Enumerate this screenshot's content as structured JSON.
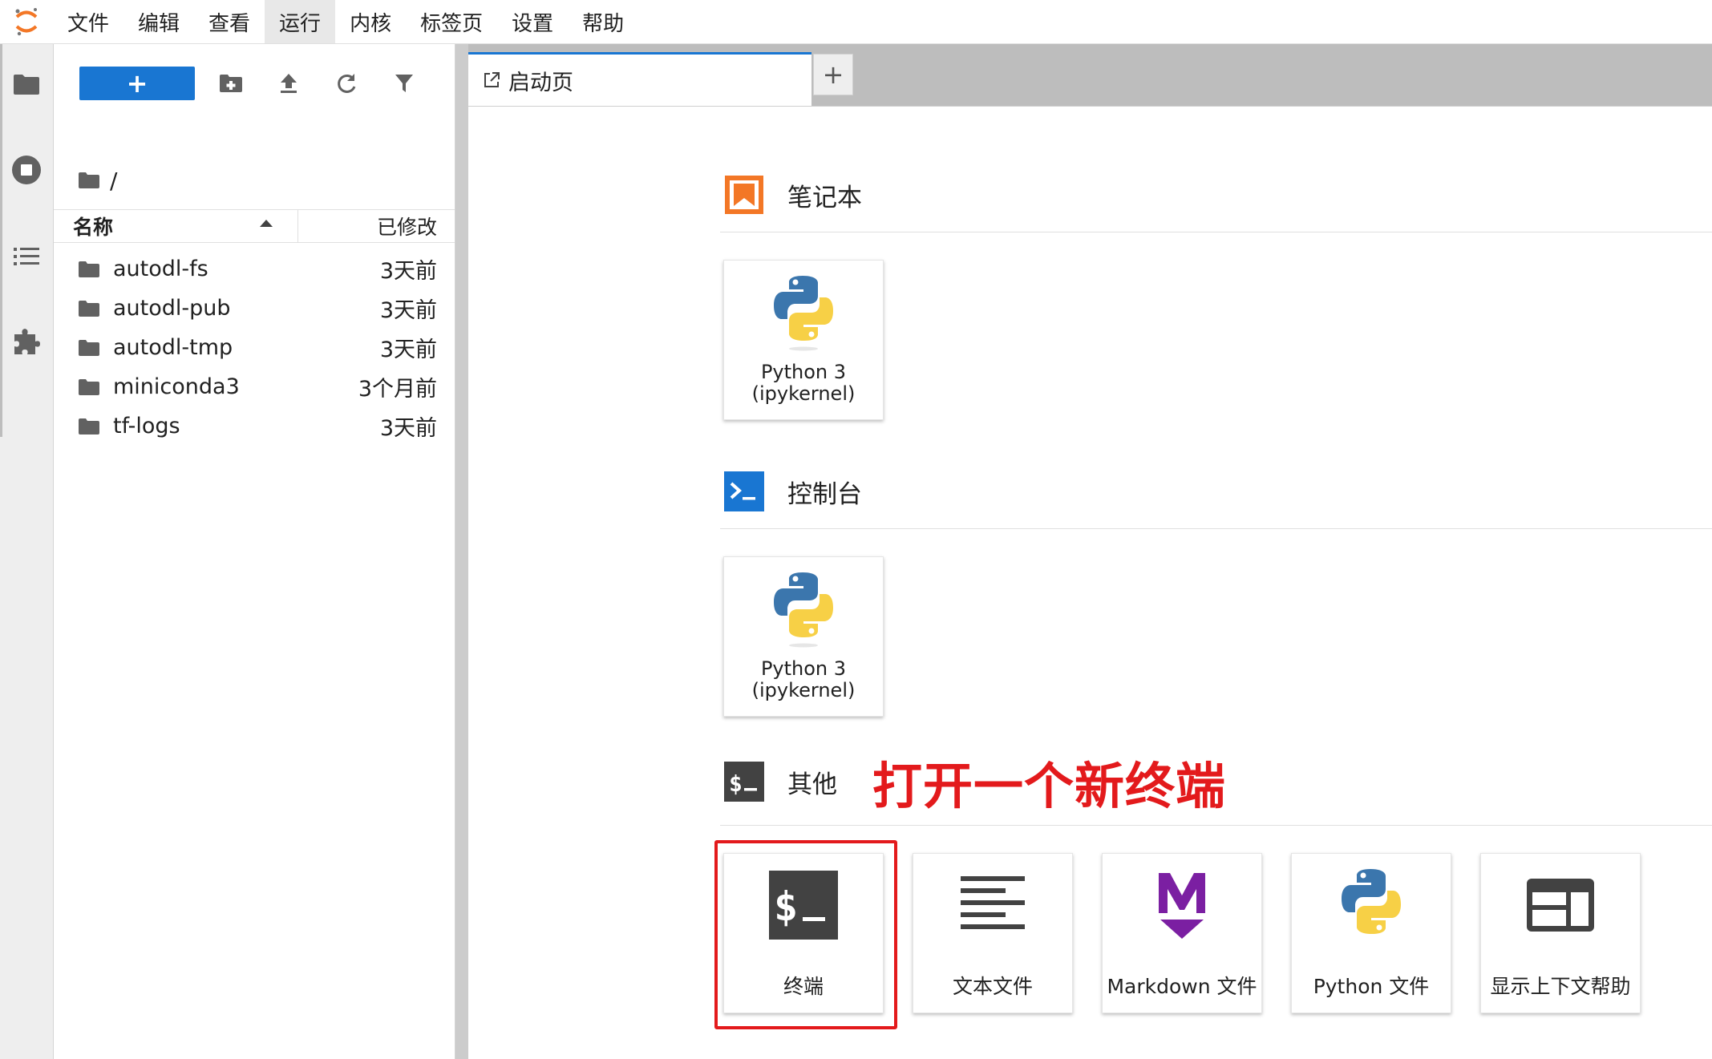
{
  "menubar": {
    "items": [
      "文件",
      "编辑",
      "查看",
      "运行",
      "内核",
      "标签页",
      "设置",
      "帮助"
    ],
    "active_index": 3
  },
  "filebrowser": {
    "breadcrumb": "/",
    "columns": {
      "name": "名称",
      "modified": "已修改"
    },
    "files": [
      {
        "name": "autodl-fs",
        "modified": "3天前",
        "icon": "folder-icon"
      },
      {
        "name": "autodl-pub",
        "modified": "3天前",
        "icon": "folder-icon"
      },
      {
        "name": "autodl-tmp",
        "modified": "3天前",
        "icon": "folder-icon"
      },
      {
        "name": "miniconda3",
        "modified": "3个月前",
        "icon": "folder-icon"
      },
      {
        "name": "tf-logs",
        "modified": "3天前",
        "icon": "folder-icon"
      }
    ]
  },
  "tabs": [
    {
      "label": "启动页",
      "icon": "launch-icon"
    }
  ],
  "launcher": {
    "sections": [
      {
        "title": "笔记本",
        "icon": "notebook-icon",
        "cards": [
          {
            "label_line1": "Python 3",
            "label_line2": "(ipykernel)",
            "icon": "python-icon"
          }
        ]
      },
      {
        "title": "控制台",
        "icon": "console-icon",
        "cards": [
          {
            "label_line1": "Python 3",
            "label_line2": "(ipykernel)",
            "icon": "python-icon"
          }
        ]
      },
      {
        "title": "其他",
        "icon": "terminal-icon",
        "annotation": "打开一个新终端",
        "cards": [
          {
            "label": "终端",
            "icon": "terminal-icon"
          },
          {
            "label": "文本文件",
            "icon": "text-file-icon"
          },
          {
            "label": "Markdown 文件",
            "icon": "markdown-icon"
          },
          {
            "label": "Python 文件",
            "icon": "python-icon"
          },
          {
            "label": "显示上下文帮助",
            "icon": "context-help-icon"
          }
        ]
      }
    ]
  },
  "colors": {
    "accent": "#1976d2",
    "annotation": "#e31a1c",
    "notebook_orange": "#f37726",
    "markdown_purple": "#7b1fa2",
    "python_blue": "#3b76ad",
    "python_yellow": "#f7d046"
  }
}
